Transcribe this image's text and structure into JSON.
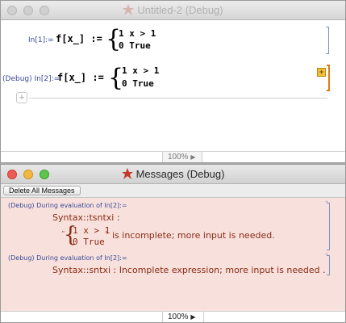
{
  "notebook": {
    "title": "Untitled-2 (Debug)",
    "cells": [
      {
        "label": "In[1]:=",
        "expr": "f[x_] := ",
        "row1": "1  x > 1",
        "row2": "0  True"
      },
      {
        "label": "(Debug) In[2]:=",
        "expr": "f[x_] := ",
        "row1": "1  x > 1",
        "row2": "0  True"
      }
    ],
    "debug_button": "+",
    "insert_button": "+",
    "zoom": "100%",
    "zoom_arrow": "▶"
  },
  "messages": {
    "title": "Messages (Debug)",
    "delete_all_label": "Delete All Messages",
    "items": [
      {
        "header": "(Debug) During evaluation of In[2]:=",
        "tag": "Syntax::tsntxi :",
        "row1": "1  x > 1",
        "row2": "0  True",
        "open_quote": "\"",
        "close_quote": "\"",
        "text": "is incomplete; more input is needed."
      },
      {
        "header": "(Debug) During evaluation of In[2]:=",
        "text": "Syntax::sntxi :  Incomplete expression; more input is needed ."
      }
    ],
    "zoom": "100%",
    "zoom_arrow": "▶"
  },
  "colors": {
    "label_blue": "#3a4a9a",
    "pattern_green": "#3c8a3c",
    "message_brown": "#8a2a14",
    "message_background": "#f8e1dc",
    "debug_orange": "#e07b13"
  },
  "icons": [
    "close-icon",
    "minimize-icon",
    "zoom-icon",
    "mathematica-icon",
    "debug-add-icon",
    "insert-cell-icon",
    "zoom-arrow-icon"
  ]
}
